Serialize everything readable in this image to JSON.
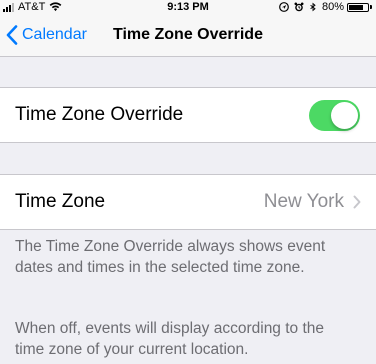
{
  "status_bar": {
    "carrier": "AT&T",
    "time": "9:13 PM",
    "battery_percent": "80%",
    "battery_level": 0.8,
    "icons": [
      "signal-icon",
      "wifi-icon",
      "location-icon",
      "alarm-icon",
      "bluetooth-icon",
      "battery-icon"
    ]
  },
  "nav": {
    "back_label": "Calendar",
    "title": "Time Zone Override"
  },
  "override_cell": {
    "label": "Time Zone Override",
    "toggle_on": true,
    "toggle_color": "#4cd964"
  },
  "timezone_cell": {
    "label": "Time Zone",
    "value": "New York"
  },
  "footer": {
    "line1": "The Time Zone Override always shows event dates and times in the selected time zone.",
    "line2": "When off, events will display according to the time zone of your current location."
  },
  "colors": {
    "accent": "#007aff",
    "background": "#efeff4",
    "secondary_text": "#8e8e93"
  }
}
